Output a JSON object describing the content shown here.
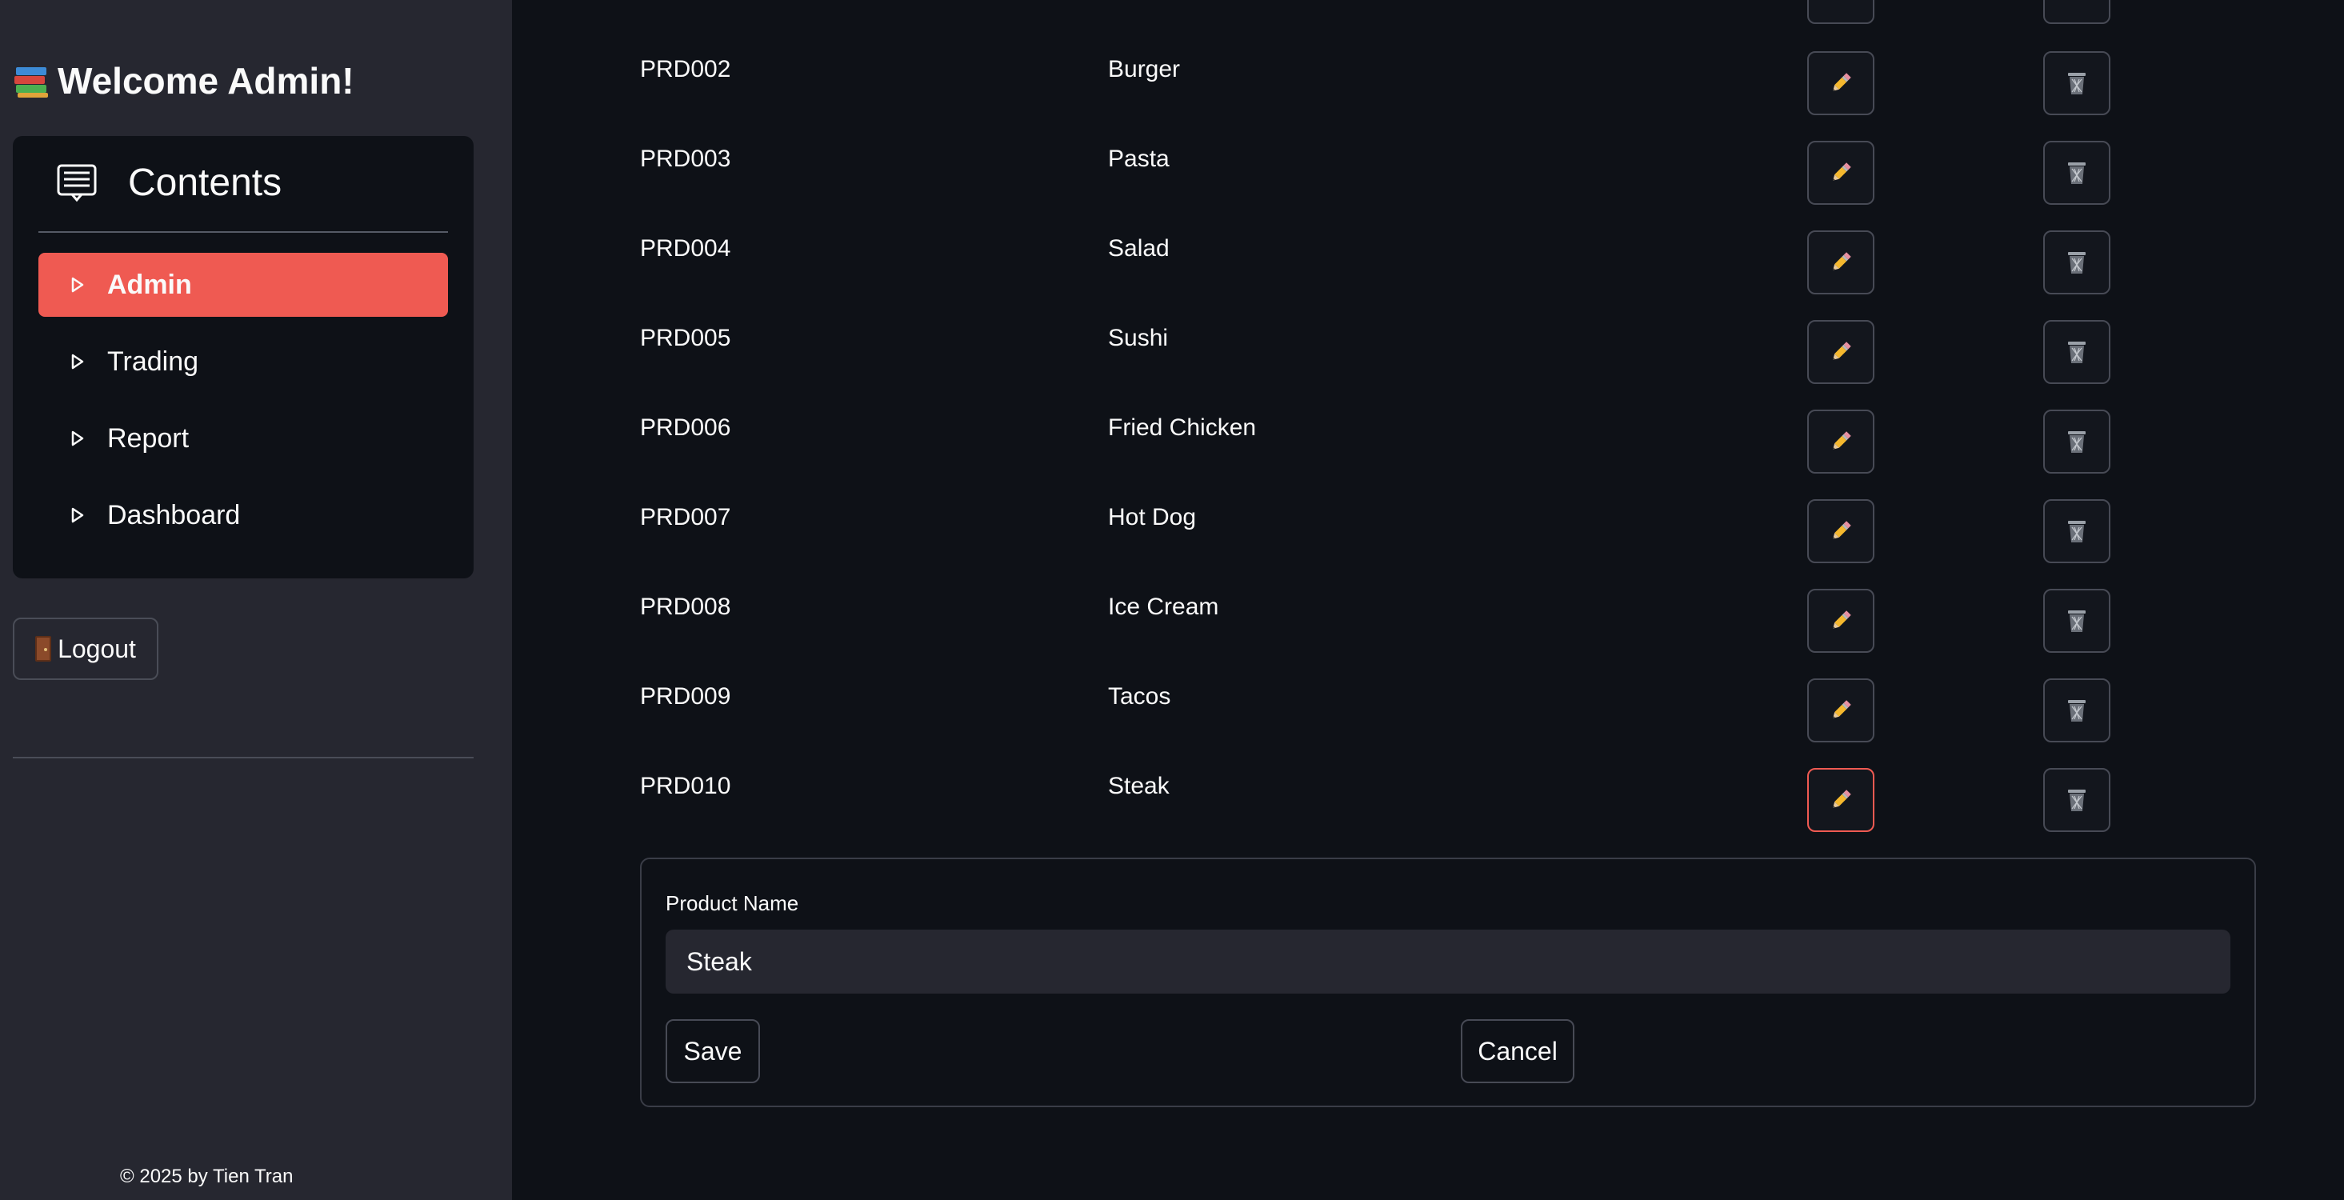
{
  "sidebar": {
    "welcome": "Welcome Admin!",
    "menu_title": "Contents",
    "items": [
      {
        "label": "Admin",
        "active": true
      },
      {
        "label": "Trading",
        "active": false
      },
      {
        "label": "Report",
        "active": false
      },
      {
        "label": "Dashboard",
        "active": false
      }
    ],
    "logout_label": "Logout",
    "footer": "© 2025 by Tien Tran"
  },
  "table": {
    "rows": [
      {
        "id": "PRD002",
        "name": "Burger"
      },
      {
        "id": "PRD003",
        "name": "Pasta"
      },
      {
        "id": "PRD004",
        "name": "Salad"
      },
      {
        "id": "PRD005",
        "name": "Sushi"
      },
      {
        "id": "PRD006",
        "name": "Fried Chicken"
      },
      {
        "id": "PRD007",
        "name": "Hot Dog"
      },
      {
        "id": "PRD008",
        "name": "Ice Cream"
      },
      {
        "id": "PRD009",
        "name": "Tacos"
      },
      {
        "id": "PRD010",
        "name": "Steak"
      }
    ],
    "edit_icon": "pencil-icon",
    "delete_icon": "wastebasket-icon"
  },
  "edit_form": {
    "label": "Product Name",
    "value": "Steak",
    "save_label": "Save",
    "cancel_label": "Cancel"
  },
  "colors": {
    "accent": "#ef5a52",
    "sidebar_bg": "#262730",
    "main_bg": "#0e1117"
  }
}
